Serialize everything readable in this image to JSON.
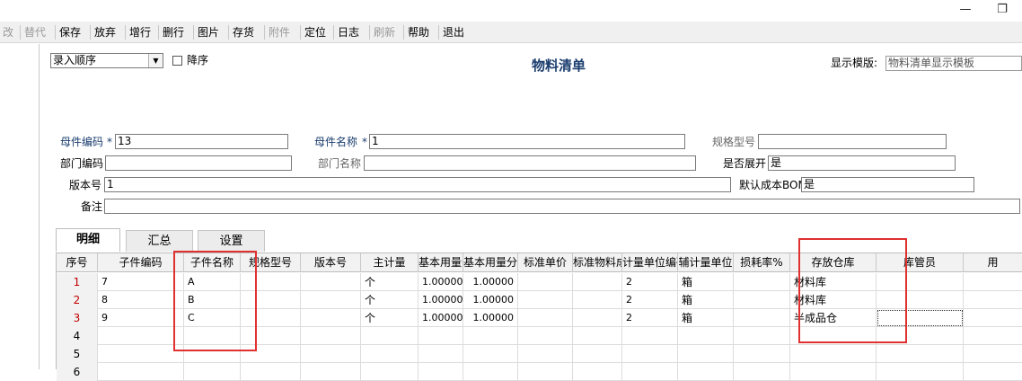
{
  "window": {
    "restore_glyph": "❐",
    "minimize_glyph": "—"
  },
  "toolbar": {
    "items": [
      {
        "label": "改",
        "enabled": false
      },
      {
        "label": "替代",
        "enabled": false
      },
      {
        "label": "保存",
        "enabled": true
      },
      {
        "label": "放弃",
        "enabled": true
      },
      {
        "label": "增行",
        "enabled": true
      },
      {
        "label": "删行",
        "enabled": true
      },
      {
        "label": "图片",
        "enabled": true
      },
      {
        "label": "存货",
        "enabled": true
      },
      {
        "label": "附件",
        "enabled": false
      },
      {
        "label": "定位",
        "enabled": true
      },
      {
        "label": "日志",
        "enabled": true
      },
      {
        "label": "刷新",
        "enabled": false
      },
      {
        "label": "帮助",
        "enabled": true
      },
      {
        "label": "退出",
        "enabled": true
      }
    ]
  },
  "header": {
    "sort_select": "录入顺序",
    "desc_label": "降序",
    "title": "物料清单",
    "template_label": "显示模版:",
    "template_value": "物料清单显示模板"
  },
  "form": {
    "parent_code_label": "母件编码",
    "parent_code_req": "*",
    "parent_code": "13",
    "parent_name_label": "母件名称",
    "parent_name_req": "*",
    "parent_name": "1",
    "spec_label": "规格型号",
    "spec": "",
    "dept_code_label": "部门编码",
    "dept_code": "",
    "dept_name_label": "部门名称",
    "dept_name": "",
    "expand_label": "是否展开",
    "expand": "是",
    "version_label": "版本号",
    "version": "1",
    "default_bom_label": "默认成本BOM",
    "default_bom": "是",
    "note_label": "备注",
    "note": ""
  },
  "tabs": [
    {
      "label": "明细",
      "active": true
    },
    {
      "label": "汇总",
      "active": false
    },
    {
      "label": "设置",
      "active": false
    }
  ],
  "grid": {
    "headers": [
      "序号",
      "子件编码",
      "子件名称",
      "规格型号",
      "版本号",
      "主计量",
      "基本用量分子",
      "基本用量分母",
      "标准单价",
      "标准物料成本",
      "计量单位编码",
      "辅计量单位",
      "损耗率%",
      "存放仓库",
      "库管员",
      "用"
    ],
    "rows": [
      {
        "no": "1",
        "code": "7",
        "name": "A",
        "spec": "",
        "ver": "",
        "unit": "个",
        "num": "1.00000",
        "den": "1.00000",
        "price": "",
        "cost": "",
        "ucode": "2",
        "aux": "箱",
        "loss": "",
        "wh": "材料库",
        "keeper": ""
      },
      {
        "no": "2",
        "code": "8",
        "name": "B",
        "spec": "",
        "ver": "",
        "unit": "个",
        "num": "1.00000",
        "den": "1.00000",
        "price": "",
        "cost": "",
        "ucode": "2",
        "aux": "箱",
        "loss": "",
        "wh": "材料库",
        "keeper": ""
      },
      {
        "no": "3",
        "code": "9",
        "name": "C",
        "spec": "",
        "ver": "",
        "unit": "个",
        "num": "1.00000",
        "den": "1.00000",
        "price": "",
        "cost": "",
        "ucode": "2",
        "aux": "箱",
        "loss": "",
        "wh": "半成品仓",
        "keeper": ""
      },
      {
        "no": "4",
        "code": "",
        "name": "",
        "spec": "",
        "ver": "",
        "unit": "",
        "num": "",
        "den": "",
        "price": "",
        "cost": "",
        "ucode": "",
        "aux": "",
        "loss": "",
        "wh": "",
        "keeper": ""
      },
      {
        "no": "5",
        "code": "",
        "name": "",
        "spec": "",
        "ver": "",
        "unit": "",
        "num": "",
        "den": "",
        "price": "",
        "cost": "",
        "ucode": "",
        "aux": "",
        "loss": "",
        "wh": "",
        "keeper": ""
      },
      {
        "no": "6",
        "code": "",
        "name": "",
        "spec": "",
        "ver": "",
        "unit": "",
        "num": "",
        "den": "",
        "price": "",
        "cost": "",
        "ucode": "",
        "aux": "",
        "loss": "",
        "wh": "",
        "keeper": ""
      }
    ]
  },
  "colors": {
    "title_blue": "#1a3d6e",
    "row_number_red": "#c00000",
    "highlight_red": "#e03030"
  }
}
